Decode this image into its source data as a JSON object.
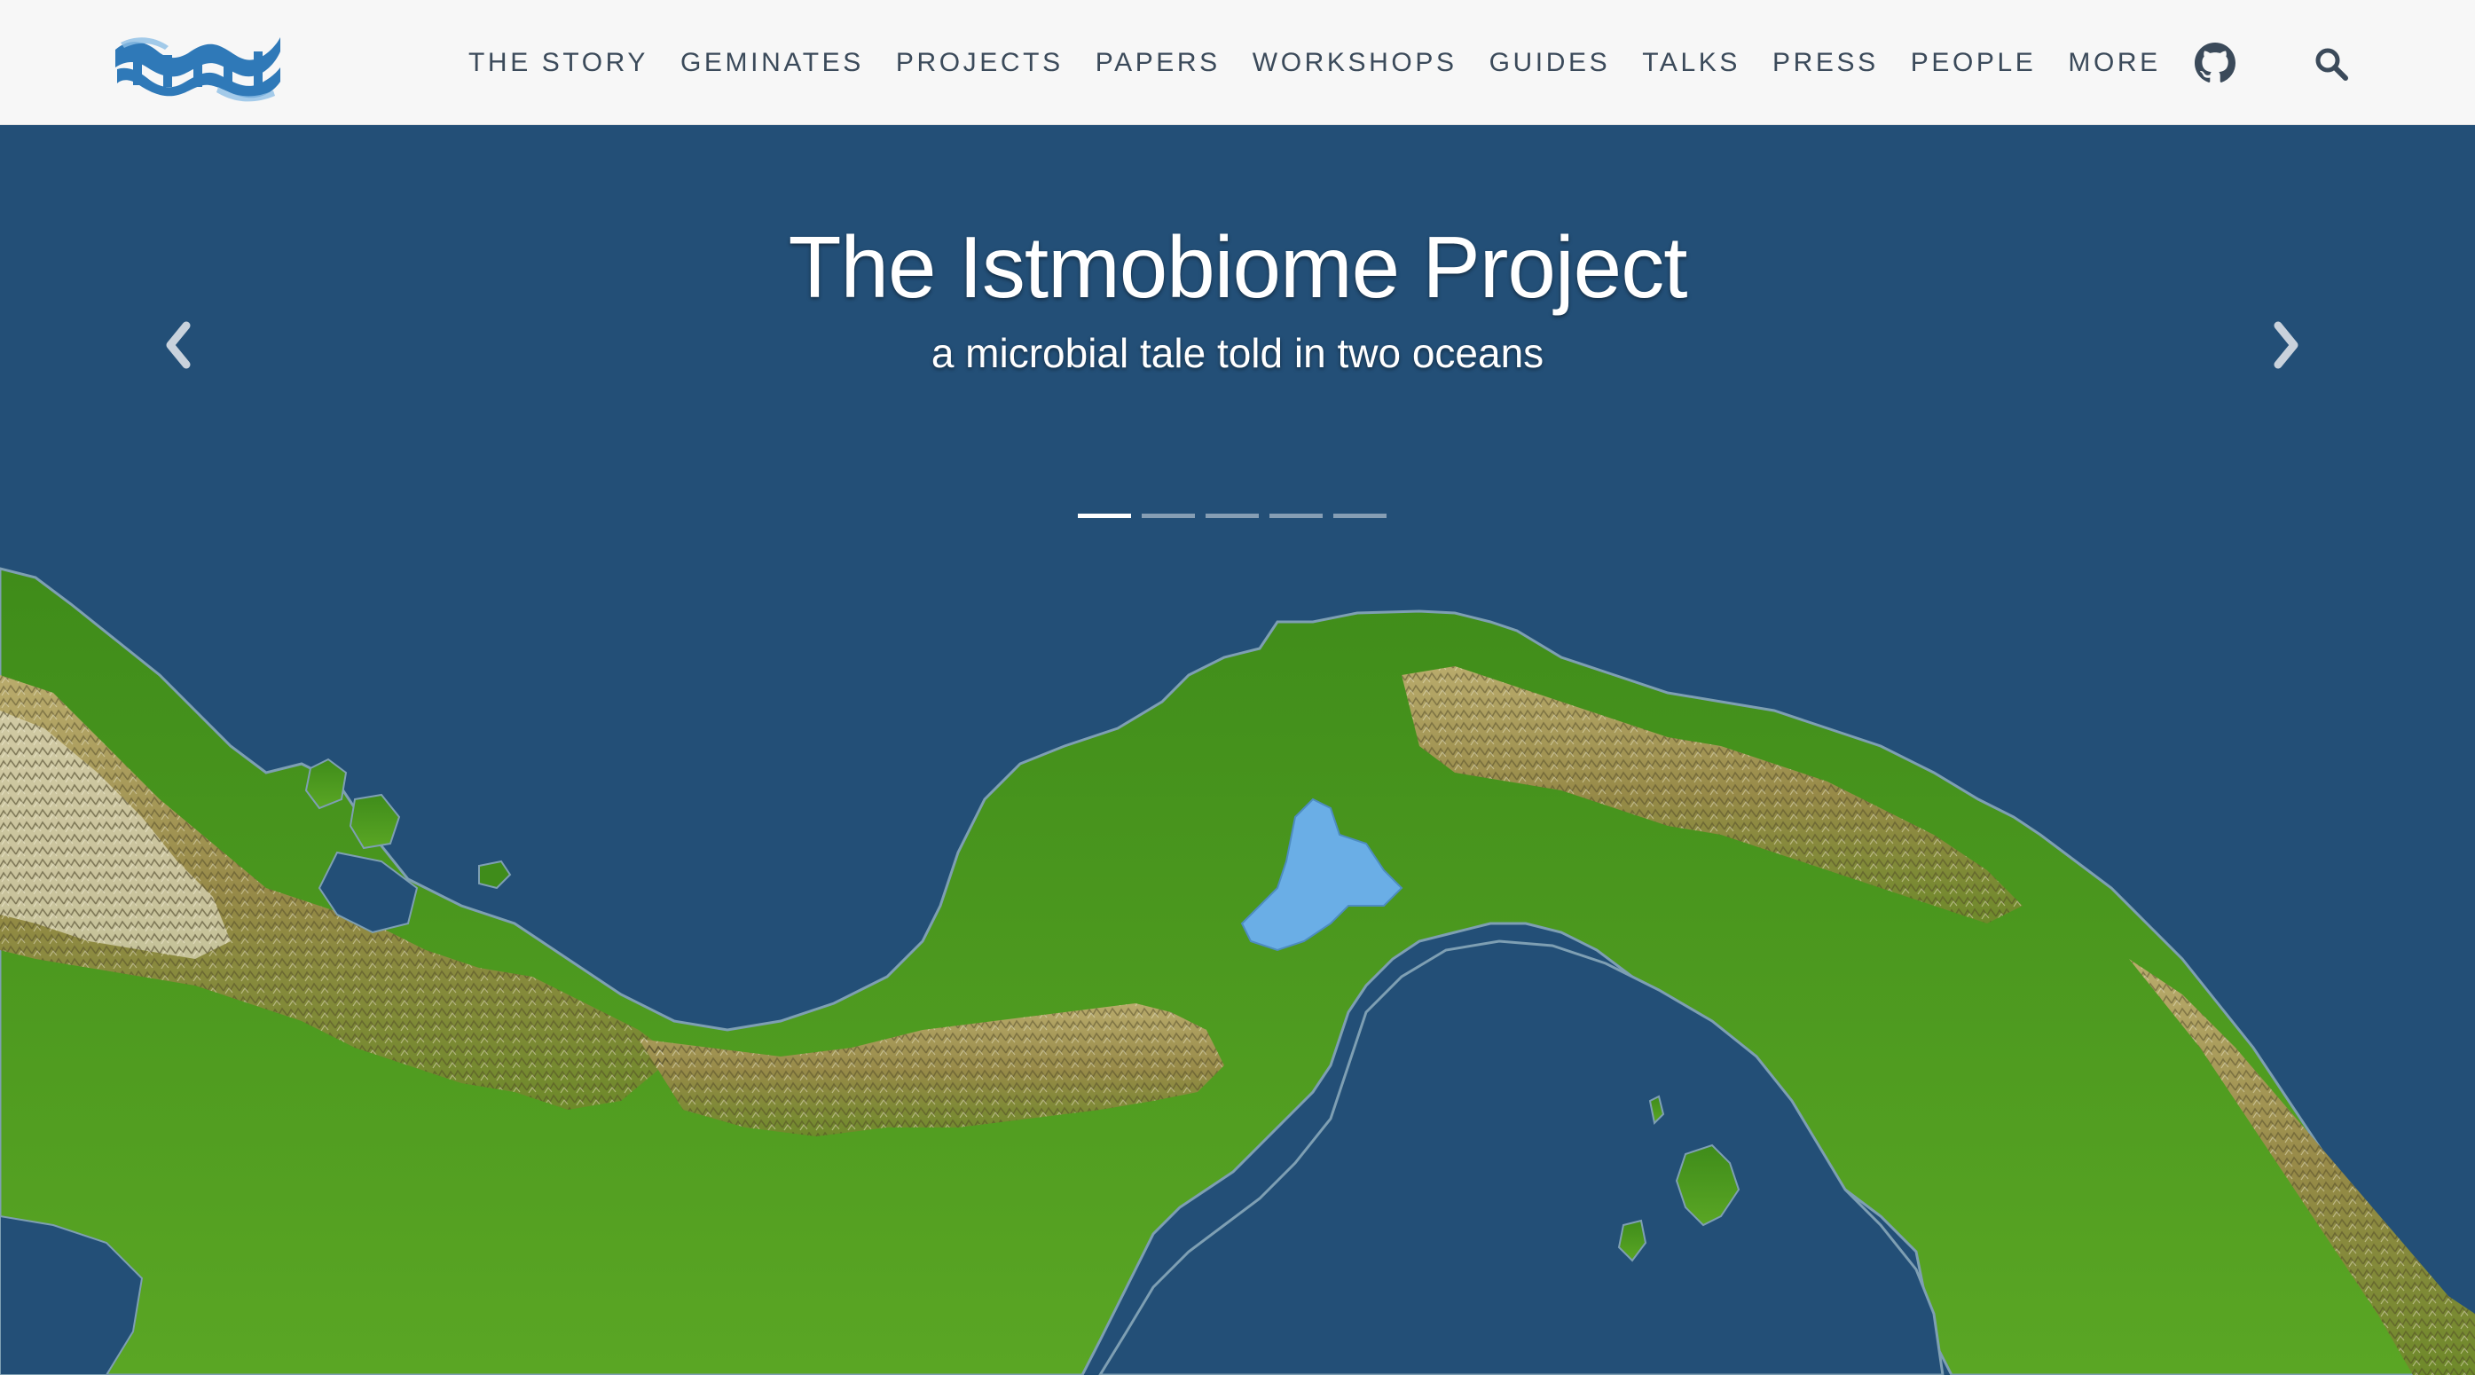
{
  "header": {
    "logo_icon": "dna-isthmus-logo",
    "nav": [
      {
        "label": "THE STORY"
      },
      {
        "label": "GEMINATES"
      },
      {
        "label": "PROJECTS"
      },
      {
        "label": "PAPERS"
      },
      {
        "label": "WORKSHOPS"
      },
      {
        "label": "GUIDES"
      },
      {
        "label": "TALKS"
      },
      {
        "label": "PRESS"
      },
      {
        "label": "PEOPLE"
      },
      {
        "label": "MORE"
      }
    ],
    "github_icon": "github-icon",
    "search_icon": "search-icon"
  },
  "hero": {
    "title": "The Istmobiome Project",
    "subtitle": "a microbial tale told in two oceans",
    "prev_icon": "chevron-left-icon",
    "next_icon": "chevron-right-icon",
    "slides_count": 5,
    "active_slide": 1,
    "background": "relief-map-isthmus-of-panama"
  },
  "colors": {
    "ocean": "#234f77",
    "navbar_bg": "#f7f7f7",
    "nav_text": "#3b4a5a",
    "logo_blue": "#1f6fb3",
    "land_green": "#4f9a1e",
    "mountain_tan": "#a89a55",
    "lake_blue": "#6aaee6"
  }
}
